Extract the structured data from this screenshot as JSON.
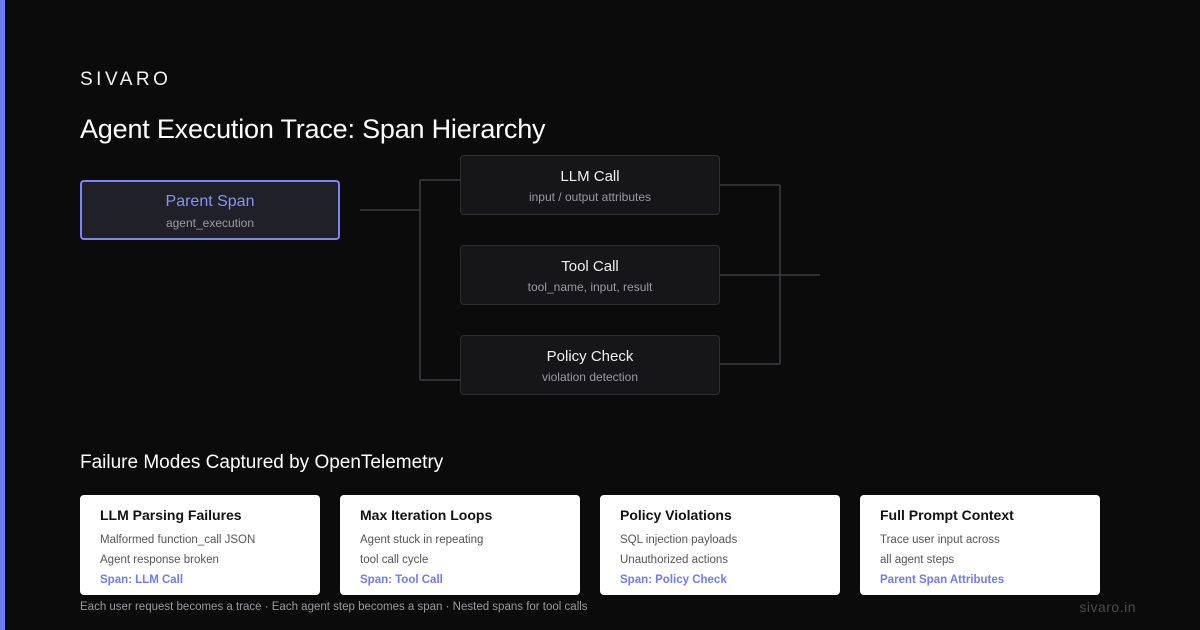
{
  "brand": "SIVARO",
  "title": "Agent Execution Trace: Span Hierarchy",
  "diagram": {
    "parent": {
      "title": "Parent Span",
      "subtitle": "agent_execution"
    },
    "children": [
      {
        "title": "LLM Call",
        "subtitle": "input / output attributes"
      },
      {
        "title": "Tool Call",
        "subtitle": "tool_name, input, result"
      },
      {
        "title": "Policy Check",
        "subtitle": "violation detection"
      }
    ]
  },
  "failure_section": {
    "title": "Failure Modes Captured by OpenTelemetry",
    "cards": [
      {
        "title": "LLM Parsing Failures",
        "lines": [
          "Malformed function_call JSON",
          "Agent response broken"
        ],
        "span": "Span: LLM Call"
      },
      {
        "title": "Max Iteration Loops",
        "lines": [
          "Agent stuck in repeating",
          "tool call cycle"
        ],
        "span": "Span: Tool Call"
      },
      {
        "title": "Policy Violations",
        "lines": [
          "SQL injection payloads",
          "Unauthorized actions"
        ],
        "span": "Span: Policy Check"
      },
      {
        "title": "Full Prompt Context",
        "lines": [
          "Trace user input across",
          "all agent steps"
        ],
        "span": "Parent Span Attributes"
      }
    ]
  },
  "footer": {
    "note": "Each user request becomes a trace · Each agent step becomes a span · Nested spans for tool calls",
    "domain": "sivaro.in"
  },
  "colors": {
    "accent": "#6f7cf0",
    "background": "#0b0b0c",
    "card": "#ffffff",
    "node": "#161618"
  }
}
